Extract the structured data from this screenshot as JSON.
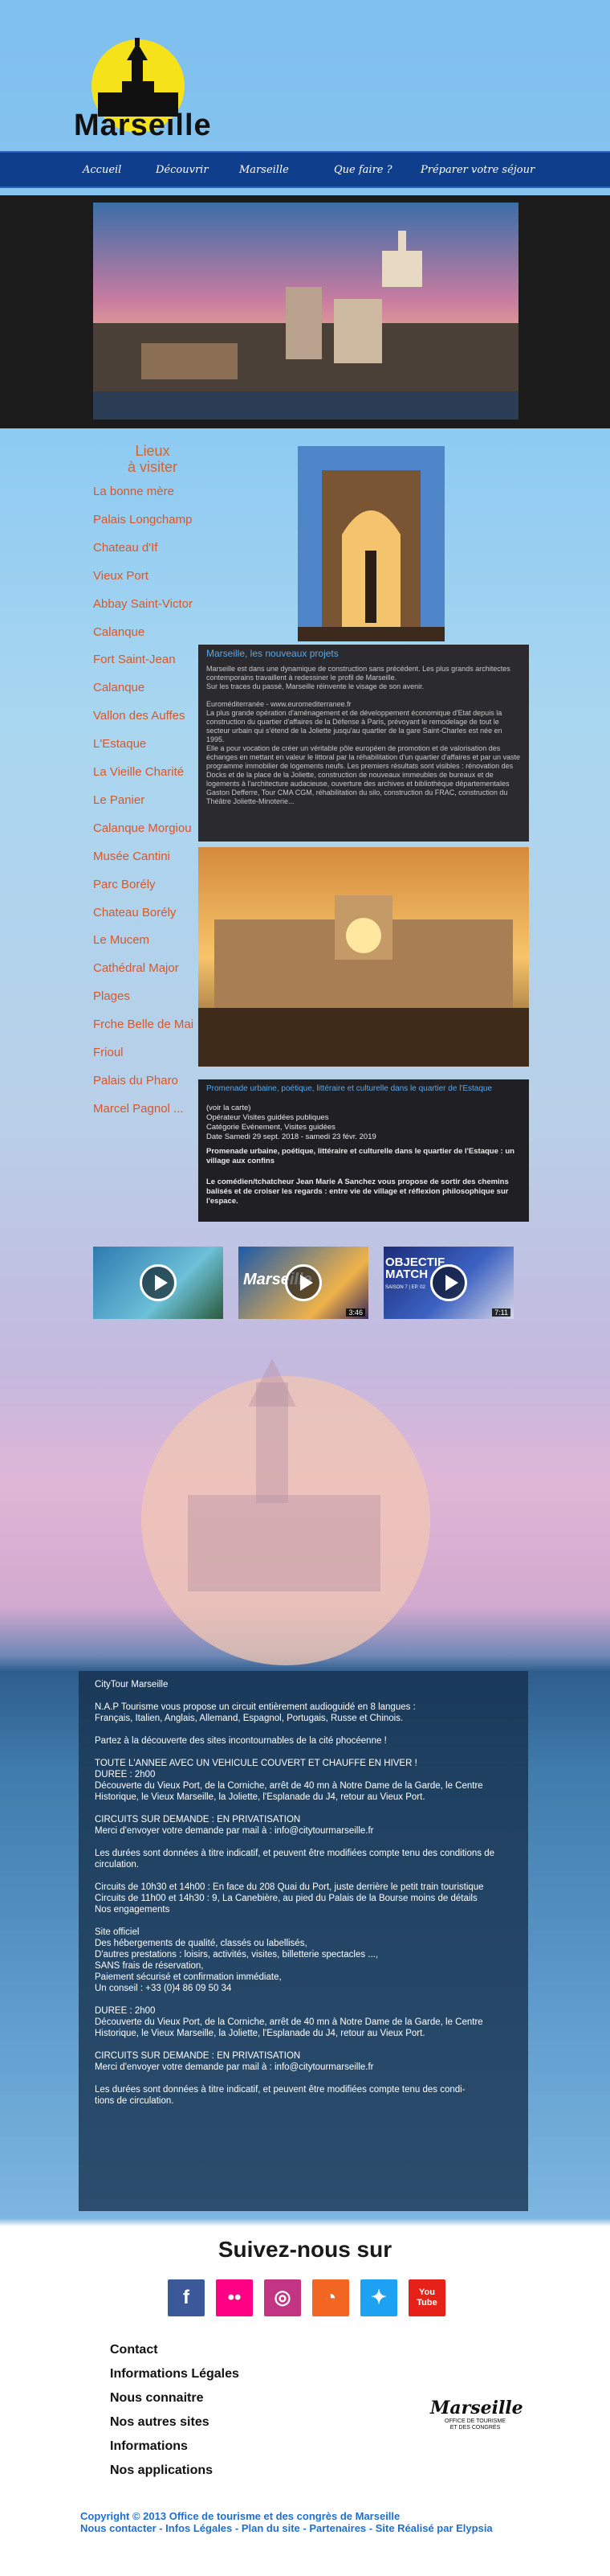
{
  "site": {
    "name": "Marseille"
  },
  "nav": [
    "Accueil",
    "Découvrir",
    "Marseille",
    "Que faire ?",
    "Préparer votre séjour"
  ],
  "sidebar": {
    "title": "Lieux\nà visiter",
    "items": [
      "La bonne mère",
      "Palais Longchamp",
      "Chateau d'If",
      "Vieux Port",
      "Abbay Saint-Victor",
      "Calanque",
      "Fort Saint-Jean",
      "Calanque",
      "Vallon des Auffes",
      "L'Estaque",
      "La Vieille Charité",
      "Le Panier",
      "Calanque Morgiou",
      "Musée Cantini",
      "Parc Borély",
      "Chateau Borély",
      "Le Mucem",
      "Cathédral Major",
      "Plages",
      "Frche Belle de Mai",
      "Frioul",
      "Palais du Pharo",
      "Marcel Pagnol ..."
    ]
  },
  "projects": {
    "title": "Marseille, les nouveaux projets",
    "body": "Marseille est dans une dynamique de construction sans précédent. Les plus grands architectes contemporains travaillent à redessiner le profil de Marseille.\nSur les traces du passé, Marseille réinvente le visage de son avenir.\n\nEuroméditerranée - www.euromediterranee.fr\nLa plus grande opération d'aménagement et de développement économique d'Etat depuis la construction du quartier d'affaires de la Défense à Paris, prévoyant le remodelage de tout le secteur urbain qui s'étend de la Joliette jusqu'au quartier de la gare Saint-Charles est née en 1995.\nElle a pour vocation de créer un véritable pôle européen de promotion et de valorisation des échanges en mettant en valeur le littoral par la réhabilitation d'un quartier d'affaires et par un vaste programme immobilier de logements neufs. Les premiers résultats sont visibles : rénovation des Docks et de la place de la Joliette, construction de nouveaux immeubles de bureaux et de logements à l'architecture audacieuse, ouverture des archives et bibliothèque départementales Gaston Defferre, Tour CMA CGM, réhabilitation du silo, construction du FRAC, construction du Théâtre Joliette-Minoterie..."
  },
  "event": {
    "title": "Promenade urbaine, poétique, littéraire et culturelle dans le quartier de l'Estaque",
    "details": "(voir la carte)\nOpérateur Visites guidées publiques\nCatégorie Evénement, Visites guidées\nDate Samedi 29 sept. 2018 - samedi 23 févr. 2019",
    "subtitle": "Promenade urbaine, poétique, littéraire et culturelle dans le quartier de l'Estaque : un village aux confins",
    "body": "Le comédien/tchatcheur Jean Marie A Sanchez vous propose de sortir des chemins balisés et de croiser les regards : entre vie de village et réflexion philosophique sur l'espace."
  },
  "videos": [
    {
      "title": "",
      "duration": ""
    },
    {
      "title": "Marseille",
      "duration": "3:46"
    },
    {
      "title": "OBJECTIF MATCH",
      "subtitle": "SAISON 7 | EP. 02",
      "duration": "7:11"
    }
  ],
  "citytour": {
    "paragraphs": [
      "CityTour Marseille",
      "N.A.P Tourisme vous propose un circuit entièrement audioguidé en 8 langues :\nFrançais, Italien, Anglais, Allemand, Espagnol, Portugais, Russe et Chinois.",
      "Partez à la découverte des sites incontournables de la cité phocéenne !",
      "TOUTE L'ANNEE AVEC UN VEHICULE COUVERT ET CHAUFFE EN HIVER !\nDUREE : 2h00\nDécouverte du Vieux Port, de la Corniche, arrêt de 40 mn à Notre Dame de la Garde, le Centre Historique, le Vieux Marseille, la Joliette, l'Esplanade du J4, retour au Vieux Port.",
      "CIRCUITS SUR DEMANDE : EN PRIVATISATION\nMerci d'envoyer votre demande par mail à : info@citytourmarseille.fr",
      "Les durées sont données à titre indicatif, et peuvent être modifiées compte tenu des conditions de circulation.",
      "Circuits de 10h30 et 14h00 : En face du 208 Quai du Port, juste derrière le petit train touristique\nCircuits de 11h00 et 14h30 : 9, La Canebière, au pied du Palais de la Bourse moins de détails\nNos engagements",
      "Site officiel\nDes hébergements de qualité, classés ou labellisés,\nD'autres prestations : loisirs, activités, visites, billetterie spectacles ...,\nSANS frais de réservation,\nPaiement sécurisé et confirmation immédiate,\nUn conseil : +33 (0)4 86 09 50 34",
      "DUREE : 2h00\nDécouverte du Vieux Port, de la Corniche, arrêt de 40 mn à Notre Dame de la Garde, le Centre Historique, le Vieux Marseille, la Joliette, l'Esplanade du J4, retour au Vieux Port.",
      "CIRCUITS SUR DEMANDE : EN PRIVATISATION\nMerci d'envoyer votre demande par mail à : info@citytourmarseille.fr",
      "Les durées sont données à titre indicatif, et peuvent être modifiées compte tenu des condi-\ntions de circulation."
    ]
  },
  "follow": {
    "title": "Suivez-nous sur"
  },
  "social": [
    {
      "icon": "facebook-icon",
      "glyph": "f",
      "color": "#3b5998"
    },
    {
      "icon": "flickr-icon",
      "glyph": "••",
      "color": "#ff0084"
    },
    {
      "icon": "instagram-icon",
      "glyph": "◎",
      "color": "#c13584"
    },
    {
      "icon": "rss-icon",
      "glyph": "◔",
      "color": "#f26522"
    },
    {
      "icon": "twitter-icon",
      "glyph": "✦",
      "color": "#1da1f2"
    },
    {
      "icon": "youtube-icon",
      "glyph": "You\nTube",
      "color": "#e62117"
    }
  ],
  "footer": {
    "links": [
      "Contact",
      "Informations Légales",
      "Nous connaitre",
      "Nos autres sites",
      "Informations",
      "Nos applications"
    ],
    "logo_text": "Marseille",
    "logo_sub": "OFFICE DE TOURISME\nET DES CONGRÈS",
    "copyright": "Copyright © 2013 Office de tourisme et des congrès de Marseille",
    "links_line": "Nous contacter - Infos Légales - Plan du site - Partenaires - Site Réalisé par Elypsia"
  }
}
